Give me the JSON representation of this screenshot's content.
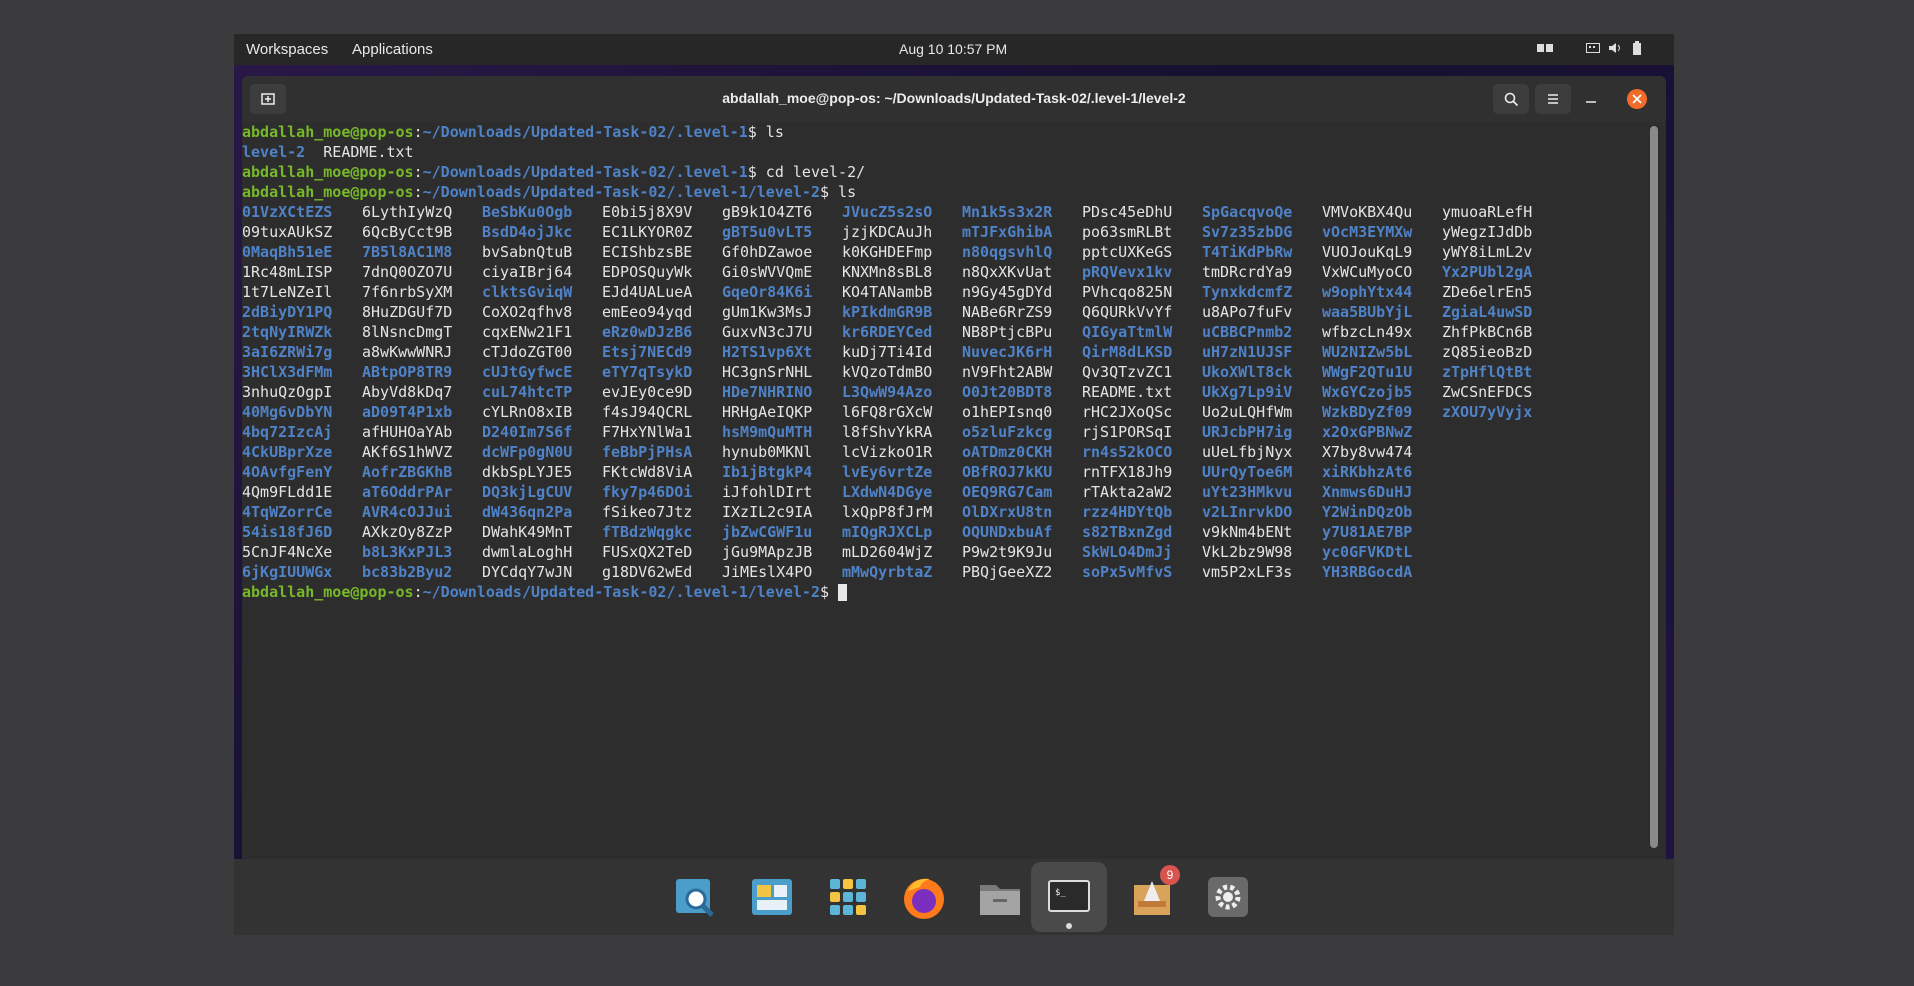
{
  "topbar": {
    "workspaces": "Workspaces",
    "applications": "Applications",
    "datetime": "Aug 10  10:57 PM"
  },
  "window": {
    "title": "abdallah_moe@pop-os: ~/Downloads/Updated-Task-02/.level-1/level-2"
  },
  "terminal": {
    "user_host": "abdallah_moe@pop-os",
    "path1": "~/Downloads/Updated-Task-02/.level-1",
    "path2": "~/Downloads/Updated-Task-02/.level-1/level-2",
    "cmd1": "$ ls",
    "out1_dir": "level-2",
    "out1_file": "README.txt",
    "cmd2": "$ cd level-2/",
    "cmd3": "$ ls",
    "prompt_end": "$ ",
    "ls_columns": [
      [
        {
          "n": "01VzXCtEZS",
          "d": true
        },
        {
          "n": "09tuxAUkSZ",
          "d": false
        },
        {
          "n": "0MaqBh51eE",
          "d": true
        },
        {
          "n": "1Rc48mLISP",
          "d": false
        },
        {
          "n": "1t7LeNZeIl",
          "d": false
        },
        {
          "n": "2dBiyDY1PQ",
          "d": true
        },
        {
          "n": "2tqNyIRWZk",
          "d": true
        },
        {
          "n": "3aI6ZRWi7g",
          "d": true
        },
        {
          "n": "3HClX3dFMm",
          "d": true
        },
        {
          "n": "3nhuQzOgpI",
          "d": false
        },
        {
          "n": "40Mg6vDbYN",
          "d": true
        },
        {
          "n": "4bq72IzcAj",
          "d": true
        },
        {
          "n": "4CkUBprXze",
          "d": true
        },
        {
          "n": "4OAvfgFenY",
          "d": true
        },
        {
          "n": "4Qm9FLdd1E",
          "d": false
        },
        {
          "n": "4TqWZorrCe",
          "d": true
        },
        {
          "n": "54is18fJ6D",
          "d": true
        },
        {
          "n": "5CnJF4NcXe",
          "d": false
        },
        {
          "n": "6jKgIUUWGx",
          "d": true
        }
      ],
      [
        {
          "n": "6LythIyWzQ",
          "d": false
        },
        {
          "n": "6QcByCct9B",
          "d": false
        },
        {
          "n": "7B5l8AC1M8",
          "d": true
        },
        {
          "n": "7dnQ0OZO7U",
          "d": false
        },
        {
          "n": "7f6nrbSyXM",
          "d": false
        },
        {
          "n": "8HuZDGUf7D",
          "d": false
        },
        {
          "n": "8lNsncDmgT",
          "d": false
        },
        {
          "n": "a8wKwwWNRJ",
          "d": false
        },
        {
          "n": "ABtpOP8TR9",
          "d": true
        },
        {
          "n": "AbyVd8kDq7",
          "d": false
        },
        {
          "n": "aD09T4P1xb",
          "d": true
        },
        {
          "n": "afHUHOaYAb",
          "d": false
        },
        {
          "n": "AKf6S1hWVZ",
          "d": false
        },
        {
          "n": "AofrZBGKhB",
          "d": true
        },
        {
          "n": "aT6OddrPAr",
          "d": true
        },
        {
          "n": "AVR4cOJJui",
          "d": true
        },
        {
          "n": "AXkzOy8ZzP",
          "d": false
        },
        {
          "n": "b8L3KxPJL3",
          "d": true
        },
        {
          "n": "bc83b2Byu2",
          "d": true
        }
      ],
      [
        {
          "n": "BeSbKu0Ogb",
          "d": true
        },
        {
          "n": "BsdD4ojJkc",
          "d": true
        },
        {
          "n": "bvSabnQtuB",
          "d": false
        },
        {
          "n": "ciyaIBrj64",
          "d": false
        },
        {
          "n": "clktsGviqW",
          "d": true
        },
        {
          "n": "CoXO2qfhv8",
          "d": false
        },
        {
          "n": "cqxENw21F1",
          "d": false
        },
        {
          "n": "cTJdoZGT00",
          "d": false
        },
        {
          "n": "cUJtGyfwcE",
          "d": true
        },
        {
          "n": "cuL74htcTP",
          "d": true
        },
        {
          "n": "cYLRnO8xIB",
          "d": false
        },
        {
          "n": "D240Im7S6f",
          "d": true
        },
        {
          "n": "dcWFp0gN0U",
          "d": true
        },
        {
          "n": "dkbSpLYJE5",
          "d": false
        },
        {
          "n": "DQ3kjLgCUV",
          "d": true
        },
        {
          "n": "dW436qn2Pa",
          "d": true
        },
        {
          "n": "DWahK49MnT",
          "d": false
        },
        {
          "n": "dwmlaLoghH",
          "d": false
        },
        {
          "n": "DYCdqY7wJN",
          "d": false
        }
      ],
      [
        {
          "n": "E0bi5j8X9V",
          "d": false
        },
        {
          "n": "EC1LKYOR0Z",
          "d": false
        },
        {
          "n": "ECIShbzsBE",
          "d": false
        },
        {
          "n": "EDPOSQuyWk",
          "d": false
        },
        {
          "n": "EJd4UALueA",
          "d": false
        },
        {
          "n": "emEeo94yqd",
          "d": false
        },
        {
          "n": "eRz0wDJzB6",
          "d": true
        },
        {
          "n": "Etsj7NECd9",
          "d": true
        },
        {
          "n": "eTY7qTsykD",
          "d": true
        },
        {
          "n": "evJEy0ce9D",
          "d": false
        },
        {
          "n": "f4sJ94QCRL",
          "d": false
        },
        {
          "n": "F7HxYNlWa1",
          "d": false
        },
        {
          "n": "feBbPjPHsA",
          "d": true
        },
        {
          "n": "FKtcWd8ViA",
          "d": false
        },
        {
          "n": "fky7p46DOi",
          "d": true
        },
        {
          "n": "fSikeo7Jtz",
          "d": false
        },
        {
          "n": "fTBdzWqgkc",
          "d": true
        },
        {
          "n": "FUSxQX2TeD",
          "d": false
        },
        {
          "n": "g18DV62wEd",
          "d": false
        }
      ],
      [
        {
          "n": "gB9k1O4ZT6",
          "d": false
        },
        {
          "n": "gBT5u0vLT5",
          "d": true
        },
        {
          "n": "Gf0hDZawoe",
          "d": false
        },
        {
          "n": "Gi0sWVVQmE",
          "d": false
        },
        {
          "n": "GqeOr84K6i",
          "d": true
        },
        {
          "n": "gUm1Kw3MsJ",
          "d": false
        },
        {
          "n": "GuxvN3cJ7U",
          "d": false
        },
        {
          "n": "H2TS1vp6Xt",
          "d": true
        },
        {
          "n": "HC3gnSrNHL",
          "d": false
        },
        {
          "n": "HDe7NHRINO",
          "d": true
        },
        {
          "n": "HRHgAeIQKP",
          "d": false
        },
        {
          "n": "hsM9mQuMTH",
          "d": true
        },
        {
          "n": "hynub0MKNl",
          "d": false
        },
        {
          "n": "Ib1jBtgkP4",
          "d": true
        },
        {
          "n": "iJfohlDIrt",
          "d": false
        },
        {
          "n": "IXzIL2c9IA",
          "d": false
        },
        {
          "n": "jbZwCGWF1u",
          "d": true
        },
        {
          "n": "jGu9MApzJB",
          "d": false
        },
        {
          "n": "JiMEslX4PO",
          "d": false
        }
      ],
      [
        {
          "n": "JVucZ5s2sO",
          "d": true
        },
        {
          "n": "jzjKDCAuJh",
          "d": false
        },
        {
          "n": "k0KGHDEFmp",
          "d": false
        },
        {
          "n": "KNXMn8sBL8",
          "d": false
        },
        {
          "n": "KO4TANambB",
          "d": false
        },
        {
          "n": "kPIkdmGR9B",
          "d": true
        },
        {
          "n": "kr6RDEYCed",
          "d": true
        },
        {
          "n": "kuDj7Ti4Id",
          "d": false
        },
        {
          "n": "kVQzoTdmBO",
          "d": false
        },
        {
          "n": "L3QwW94Azo",
          "d": true
        },
        {
          "n": "l6FQ8rGXcW",
          "d": false
        },
        {
          "n": "l8fShvYkRA",
          "d": false
        },
        {
          "n": "lcVizkoO1R",
          "d": false
        },
        {
          "n": "lvEy6vrtZe",
          "d": true
        },
        {
          "n": "LXdwN4DGye",
          "d": true
        },
        {
          "n": "lxQpP8fJrM",
          "d": false
        },
        {
          "n": "mIQgRJXCLp",
          "d": true
        },
        {
          "n": "mLD2604WjZ",
          "d": false
        },
        {
          "n": "mMwQyrbtaZ",
          "d": true
        }
      ],
      [
        {
          "n": "Mn1k5s3x2R",
          "d": true
        },
        {
          "n": "mTJFxGhibA",
          "d": true
        },
        {
          "n": "n80qgsvhlQ",
          "d": true
        },
        {
          "n": "n8QxXKvUat",
          "d": false
        },
        {
          "n": "n9Gy45gDYd",
          "d": false
        },
        {
          "n": "NABe6RrZS9",
          "d": false
        },
        {
          "n": "NB8PtjcBPu",
          "d": false
        },
        {
          "n": "NuvecJK6rH",
          "d": true
        },
        {
          "n": "nV9Fht2ABW",
          "d": false
        },
        {
          "n": "O0Jt20BDT8",
          "d": true
        },
        {
          "n": "o1hEPIsnq0",
          "d": false
        },
        {
          "n": "o5zluFzkcg",
          "d": true
        },
        {
          "n": "oATDmz0CKH",
          "d": true
        },
        {
          "n": "OBfROJ7kKU",
          "d": true
        },
        {
          "n": "OEQ9RG7Cam",
          "d": true
        },
        {
          "n": "OlDXrxU8tn",
          "d": true
        },
        {
          "n": "OQUNDxbuAf",
          "d": true
        },
        {
          "n": "P9w2t9K9Ju",
          "d": false
        },
        {
          "n": "PBQjGeeXZ2",
          "d": false
        }
      ],
      [
        {
          "n": "PDsc45eDhU",
          "d": false
        },
        {
          "n": "po63smRLBt",
          "d": false
        },
        {
          "n": "pptcUXKeGS",
          "d": false
        },
        {
          "n": "pRQVevx1kv",
          "d": true
        },
        {
          "n": "PVhcqo825N",
          "d": false
        },
        {
          "n": "Q6QURkVvYf",
          "d": false
        },
        {
          "n": "QIGyaTtmlW",
          "d": true
        },
        {
          "n": "QirM8dLKSD",
          "d": true
        },
        {
          "n": "Qv3QTzvZC1",
          "d": false
        },
        {
          "n": "README.txt",
          "d": false
        },
        {
          "n": "rHC2JXoQSc",
          "d": false
        },
        {
          "n": "rjS1PORSqI",
          "d": false
        },
        {
          "n": "rn4s52kOCO",
          "d": true
        },
        {
          "n": "rnTFX18Jh9",
          "d": false
        },
        {
          "n": "rTAkta2aW2",
          "d": false
        },
        {
          "n": "rzz4HDYtQb",
          "d": true
        },
        {
          "n": "s82TBxnZgd",
          "d": true
        },
        {
          "n": "SkWLO4DmJj",
          "d": true
        },
        {
          "n": "soPx5vMfvS",
          "d": true
        }
      ],
      [
        {
          "n": "SpGacqvoQe",
          "d": true
        },
        {
          "n": "Sv7z35zbDG",
          "d": true
        },
        {
          "n": "T4TiKdPbRw",
          "d": true
        },
        {
          "n": "tmDRcrdYa9",
          "d": false
        },
        {
          "n": "TynxkdcmfZ",
          "d": true
        },
        {
          "n": "u8APo7fuFv",
          "d": false
        },
        {
          "n": "uCBBCPnmb2",
          "d": true
        },
        {
          "n": "uH7zN1UJSF",
          "d": true
        },
        {
          "n": "UkoXWlT8ck",
          "d": true
        },
        {
          "n": "UkXg7Lp9iV",
          "d": true
        },
        {
          "n": "Uo2uLQHfWm",
          "d": false
        },
        {
          "n": "URJcbPH7ig",
          "d": true
        },
        {
          "n": "uUeLfbjNyx",
          "d": false
        },
        {
          "n": "UUrQyToe6M",
          "d": true
        },
        {
          "n": "uYt23HMkvu",
          "d": true
        },
        {
          "n": "v2LInrvkDO",
          "d": true
        },
        {
          "n": "v9kNm4bENt",
          "d": false
        },
        {
          "n": "VkL2bz9W98",
          "d": false
        },
        {
          "n": "vm5P2xLF3s",
          "d": false
        }
      ],
      [
        {
          "n": "VMVoKBX4Qu",
          "d": false
        },
        {
          "n": "vOcM3EYMXw",
          "d": true
        },
        {
          "n": "VUOJouKqL9",
          "d": false
        },
        {
          "n": "VxWCuMyoCO",
          "d": false
        },
        {
          "n": "w9ophYtx44",
          "d": true
        },
        {
          "n": "waa5BUbYjL",
          "d": true
        },
        {
          "n": "wfbzcLn49x",
          "d": false
        },
        {
          "n": "WU2NIZw5bL",
          "d": true
        },
        {
          "n": "WWgF2QTu1U",
          "d": true
        },
        {
          "n": "WxGYCzojb5",
          "d": true
        },
        {
          "n": "WzkBDyZf09",
          "d": true
        },
        {
          "n": "x2OxGPBNwZ",
          "d": true
        },
        {
          "n": "X7by8vw474",
          "d": false
        },
        {
          "n": "xiRKbhzAt6",
          "d": true
        },
        {
          "n": "Xnmws6DuHJ",
          "d": true
        },
        {
          "n": "Y2WinDQzOb",
          "d": true
        },
        {
          "n": "y7U81AE7BP",
          "d": true
        },
        {
          "n": "yc0GFVKDtL",
          "d": true
        },
        {
          "n": "YH3RBGocdA",
          "d": true
        }
      ],
      [
        {
          "n": "ymuoaRLefH",
          "d": false
        },
        {
          "n": "yWegzIJdDb",
          "d": false
        },
        {
          "n": "yWY8iLmL2v",
          "d": false
        },
        {
          "n": "Yx2PUbl2gA",
          "d": true
        },
        {
          "n": "ZDe6elrEn5",
          "d": false
        },
        {
          "n": "ZgiaL4uwSD",
          "d": true
        },
        {
          "n": "ZhfPkBCn6B",
          "d": false
        },
        {
          "n": "zQ85ieoBzD",
          "d": false
        },
        {
          "n": "zTpHflQtBt",
          "d": true
        },
        {
          "n": "ZwCSnEFDCS",
          "d": false
        },
        {
          "n": "zXOU7yVyjx",
          "d": true
        }
      ]
    ]
  },
  "dock": {
    "items": [
      {
        "icon": "search-icon"
      },
      {
        "icon": "workspaces-icon"
      },
      {
        "icon": "app-grid-icon"
      },
      {
        "icon": "firefox-icon"
      },
      {
        "icon": "files-icon"
      },
      {
        "icon": "terminal-icon"
      },
      {
        "icon": "store-icon",
        "badge": "9"
      },
      {
        "icon": "settings-icon"
      }
    ]
  },
  "colors": {
    "dir": "#4f82c7",
    "prompt_user": "#78b82a",
    "close": "#f26b2a"
  }
}
